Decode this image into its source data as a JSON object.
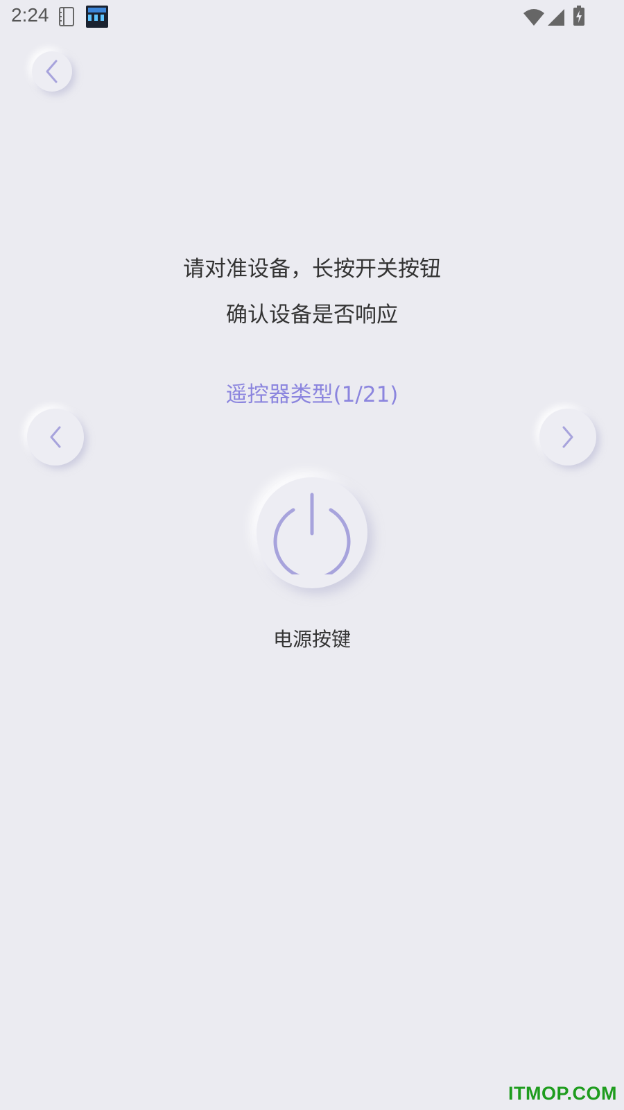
{
  "status_bar": {
    "time": "2:24",
    "icons": [
      "notebook-icon",
      "app-clock-icon",
      "wifi-icon",
      "signal-icon",
      "battery-charging-icon"
    ]
  },
  "nav": {
    "back_icon": "chevron-left-icon"
  },
  "instructions": {
    "line1": "请对准设备，长按开关按钮",
    "line2": "确认设备是否响应"
  },
  "remote": {
    "type_label": "遥控器类型(1/21)",
    "prev_icon": "chevron-left-icon",
    "next_icon": "chevron-right-icon"
  },
  "power": {
    "icon": "power-icon",
    "label": "电源按键"
  },
  "watermark": {
    "text": "ITMOP.COM"
  },
  "colors": {
    "background": "#ebebf1",
    "accent": "#8b85de",
    "icon": "#a7a3dc",
    "text": "#333333",
    "watermark": "#1e9c1e"
  }
}
